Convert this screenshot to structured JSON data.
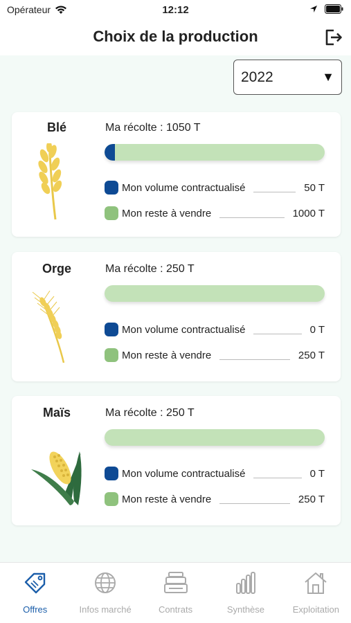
{
  "status": {
    "carrier": "Opérateur",
    "time": "12:12"
  },
  "header": {
    "title": "Choix de la production"
  },
  "year": {
    "selected": "2022"
  },
  "colors": {
    "contract": "#0e4a94",
    "remaining": "#8fc27d",
    "bar_bg": "#c3e2b8",
    "active_tab": "#1b5eaa"
  },
  "crops": [
    {
      "name": "Blé",
      "harvest": "Ma récolte : 1050 T",
      "contract_label": "Mon volume contractualisé",
      "contract_value": "50 T",
      "remaining_label": "Mon reste à vendre",
      "remaining_value": "1000 T",
      "contract_fraction": 0.048
    },
    {
      "name": "Orge",
      "harvest": "Ma récolte : 250 T",
      "contract_label": "Mon volume contractualisé",
      "contract_value": "0 T",
      "remaining_label": "Mon reste à vendre",
      "remaining_value": "250 T",
      "contract_fraction": 0
    },
    {
      "name": "Maïs",
      "harvest": "Ma récolte : 250 T",
      "contract_label": "Mon volume contractualisé",
      "contract_value": "0 T",
      "remaining_label": "Mon reste à vendre",
      "remaining_value": "250 T",
      "contract_fraction": 0
    }
  ],
  "tabs": [
    {
      "label": "Offres",
      "icon": "tag-icon",
      "active": true
    },
    {
      "label": "Infos marché",
      "icon": "globe-icon",
      "active": false
    },
    {
      "label": "Contrats",
      "icon": "documents-stack-icon",
      "active": false
    },
    {
      "label": "Synthèse",
      "icon": "bar-chart-icon",
      "active": false
    },
    {
      "label": "Exploitation",
      "icon": "farm-house-icon",
      "active": false
    }
  ]
}
